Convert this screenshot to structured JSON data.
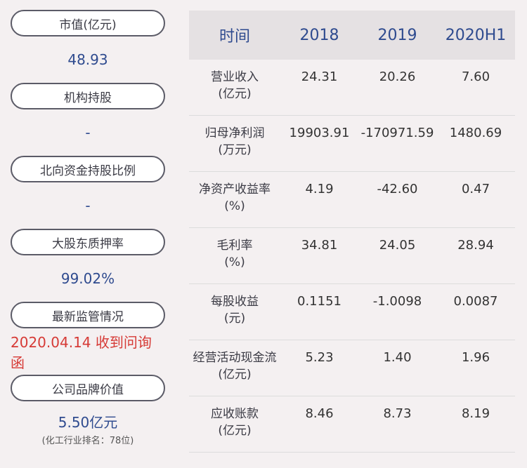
{
  "stats": [
    {
      "label": "市值(亿元)",
      "value": "48.93"
    },
    {
      "label": "机构持股",
      "value": "-"
    },
    {
      "label": "北向资金持股比例",
      "value": "-"
    },
    {
      "label": "大股东质押率",
      "value": "99.02%"
    },
    {
      "label": "最新监管情况",
      "value": "2020.04.14 收到问询函"
    },
    {
      "label": "公司品牌价值",
      "value": "5.50亿元",
      "sub": "(化工行业排名：78位)"
    }
  ],
  "table": {
    "headers": [
      "时间",
      "2018",
      "2019",
      "2020H1"
    ],
    "rows": [
      {
        "name": "营业收入",
        "unit": "(亿元)",
        "values": [
          "24.31",
          "20.26",
          "7.60"
        ]
      },
      {
        "name": "归母净利润",
        "unit": "(万元)",
        "values": [
          "19903.91",
          "-170971.59",
          "1480.69"
        ]
      },
      {
        "name": "净资产收益率",
        "unit": "(%)",
        "values": [
          "4.19",
          "-42.60",
          "0.47"
        ]
      },
      {
        "name": "毛利率",
        "unit": "(%)",
        "values": [
          "34.81",
          "24.05",
          "28.94"
        ]
      },
      {
        "name": "每股收益",
        "unit": "(元)",
        "values": [
          "0.1151",
          "-1.0098",
          "0.0087"
        ]
      },
      {
        "name": "经营活动现金流",
        "unit": "(亿元)",
        "values": [
          "5.23",
          "1.40",
          "1.96"
        ]
      },
      {
        "name": "应收账款",
        "unit": "(亿元)",
        "values": [
          "8.46",
          "8.73",
          "8.19"
        ]
      }
    ]
  },
  "colors": {
    "accent": "#2f4b8f",
    "alert": "#d63a36",
    "header_bg": "#e5e1e3",
    "page_bg": "#f4f0f1"
  }
}
